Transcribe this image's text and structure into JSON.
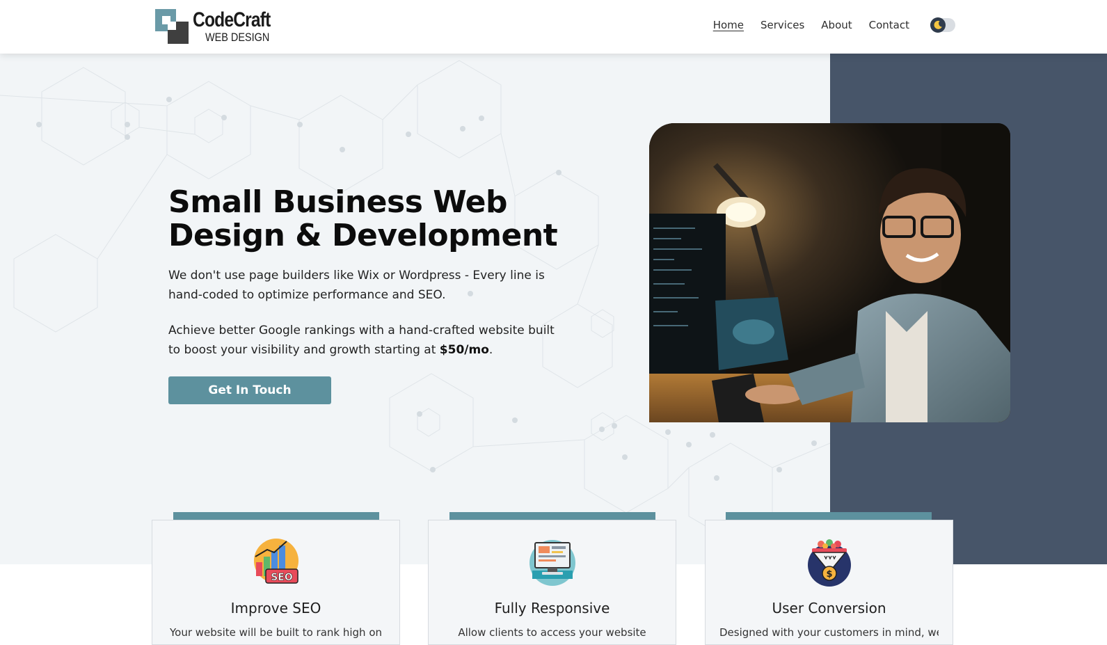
{
  "header": {
    "logo_name": "CodeCraft",
    "logo_sub": "WEB DESIGN",
    "nav": [
      {
        "label": "Home",
        "active": true
      },
      {
        "label": "Services",
        "active": false
      },
      {
        "label": "About",
        "active": false
      },
      {
        "label": "Contact",
        "active": false
      }
    ],
    "theme_toggle_icon": "moon-icon"
  },
  "hero": {
    "title": "Small Business Web Design & Development",
    "paragraph1": "We don't use page builders like Wix or Wordpress - Every line is hand-coded to optimize performance and SEO.",
    "paragraph2_prefix": "Achieve better Google rankings with a hand-crafted website built to boost your visibility and growth starting at ",
    "paragraph2_price": "$50/mo",
    "paragraph2_suffix": ".",
    "cta_label": "Get In Touch",
    "photo_icon": "developer-at-computer-photo"
  },
  "cards": [
    {
      "icon": "seo-growth-chart-icon",
      "title": "Improve SEO",
      "text": "Your website will be built to rank high on"
    },
    {
      "icon": "responsive-devices-icon",
      "title": "Fully Responsive",
      "text": "Allow clients to access your website"
    },
    {
      "icon": "conversion-funnel-icon",
      "title": "User Conversion",
      "text": "Designed with your customers in mind, we"
    }
  ],
  "colors": {
    "accent": "#5d919e",
    "dark_panel": "#475569",
    "hero_bg": "#f2f5f7"
  }
}
